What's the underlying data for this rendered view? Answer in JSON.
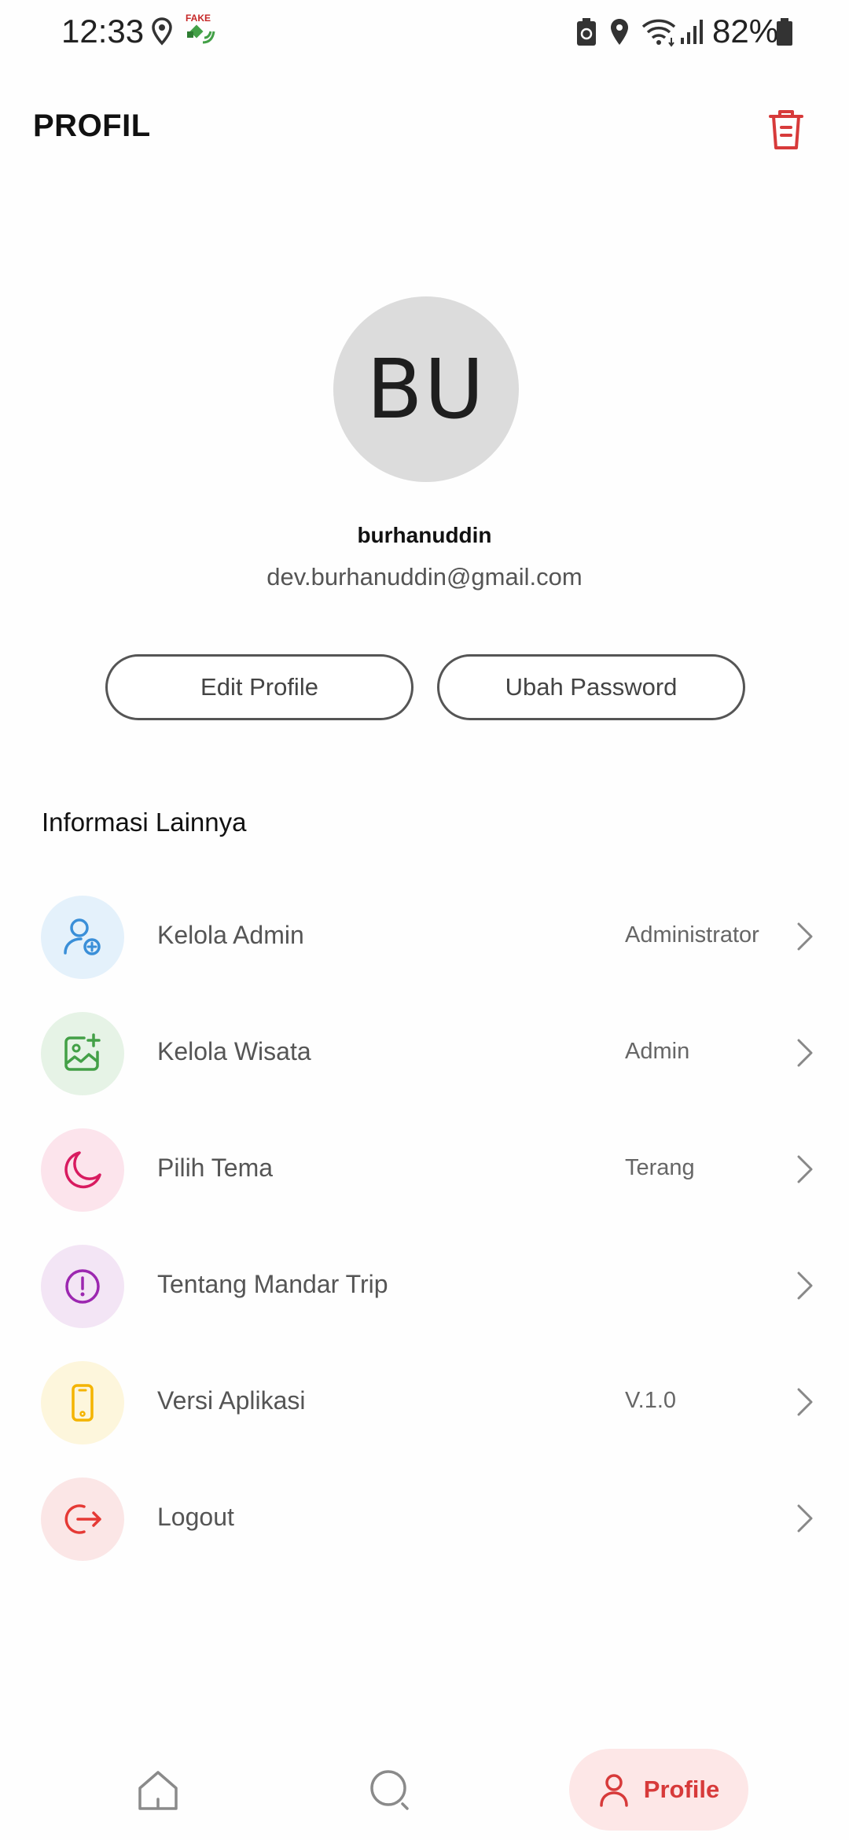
{
  "status_bar": {
    "time": "12:33",
    "fake_badge": "FAKE",
    "battery_percent": "82%"
  },
  "header": {
    "title": "PROFIL",
    "delete_icon": "trash-icon",
    "delete_color": "#d73a3a"
  },
  "profile": {
    "initials": "BU",
    "name": "burhanuddin",
    "email": "dev.burhanuddin@gmail.com",
    "edit_label": "Edit Profile",
    "password_label": "Ubah Password"
  },
  "section": {
    "title": "Informasi Lainnya"
  },
  "menu": [
    {
      "label": "Kelola Admin",
      "value": "Administrator",
      "icon": "user-add-icon",
      "color": "#3a8fd8",
      "bg": "#e4f1fb"
    },
    {
      "label": "Kelola Wisata",
      "value": "Admin",
      "icon": "image-add-icon",
      "color": "#43a047",
      "bg": "#e6f3e6"
    },
    {
      "label": "Pilih Tema",
      "value": "Terang",
      "icon": "moon-icon",
      "color": "#d81b60",
      "bg": "#fce4ec"
    },
    {
      "label": "Tentang Mandar Trip",
      "value": "",
      "icon": "info-icon",
      "color": "#9c27b0",
      "bg": "#f3e5f5"
    },
    {
      "label": "Versi Aplikasi",
      "value": "V.1.0",
      "icon": "phone-icon",
      "color": "#f4b400",
      "bg": "#fdf6dc"
    },
    {
      "label": "Logout",
      "value": "",
      "icon": "logout-icon",
      "color": "#e53935",
      "bg": "#fbe6e6"
    }
  ],
  "bottom_nav": {
    "profile_label": "Profile",
    "active_color": "#d73a3a",
    "active_bg": "#fde7e7"
  }
}
